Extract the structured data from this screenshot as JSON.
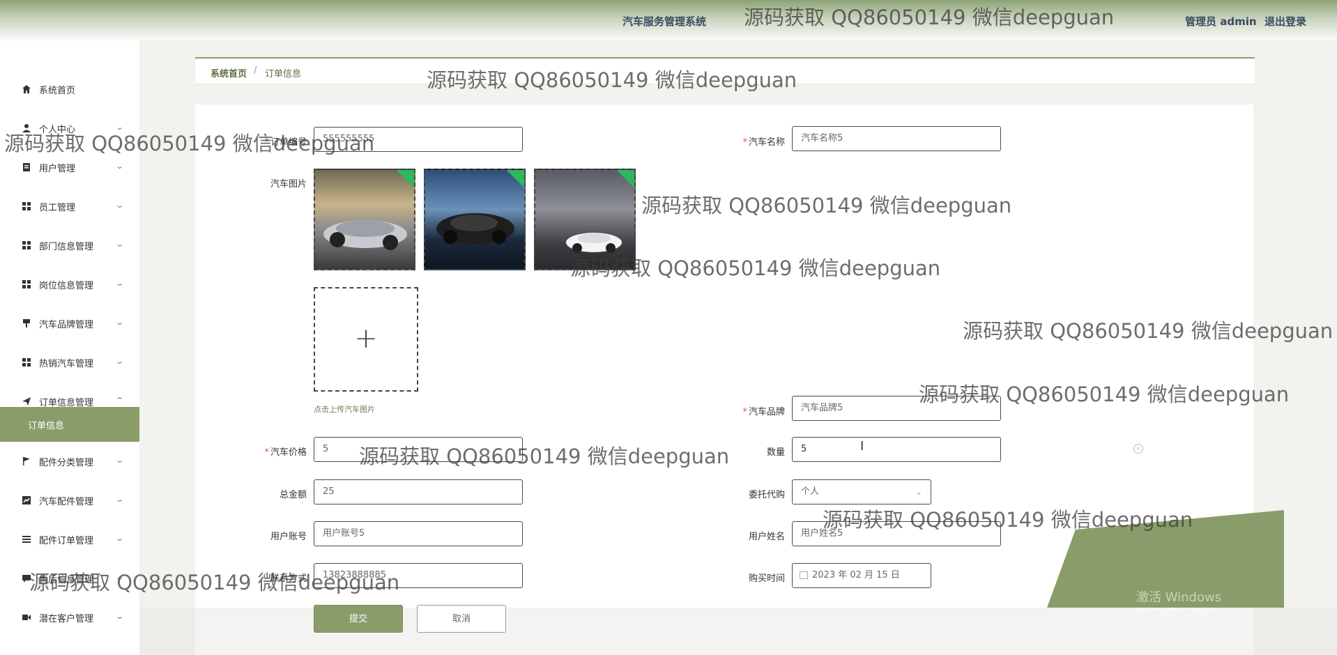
{
  "header": {
    "system_title": "汽车服务管理系统",
    "admin_label": "管理员 admin",
    "logout_label": "退出登录"
  },
  "sidebar": {
    "items": [
      {
        "label": "系统首页",
        "icon": "home-icon"
      },
      {
        "label": "个人中心",
        "icon": "user-icon"
      },
      {
        "label": "用户管理",
        "icon": "document-icon"
      },
      {
        "label": "员工管理",
        "icon": "grid-icon"
      },
      {
        "label": "部门信息管理",
        "icon": "grid-icon"
      },
      {
        "label": "岗位信息管理",
        "icon": "grid-icon"
      },
      {
        "label": "汽车品牌管理",
        "icon": "brush-icon"
      },
      {
        "label": "热销汽车管理",
        "icon": "grid-icon"
      },
      {
        "label": "订单信息管理",
        "icon": "send-icon"
      },
      {
        "label": "配件分类管理",
        "icon": "flag-icon"
      },
      {
        "label": "汽车配件管理",
        "icon": "chart-icon"
      },
      {
        "label": "配件订单管理",
        "icon": "list-icon"
      },
      {
        "label": "售后信息管理",
        "icon": "chat-icon"
      },
      {
        "label": "潜在客户管理",
        "icon": "video-icon"
      }
    ],
    "active_sub_item": "订单信息"
  },
  "breadcrumb": {
    "home": "系统首页",
    "separator": "/",
    "current": "订单信息"
  },
  "form": {
    "order_no_label": "订单编号",
    "order_no_value": "555555555",
    "car_name_label": "汽车名称",
    "car_name_value": "汽车名称5",
    "car_image_label": "汽车图片",
    "upload_hint": "点击上传汽车图片",
    "car_brand_label": "汽车品牌",
    "car_brand_value": "汽车品牌5",
    "car_price_label": "汽车价格",
    "car_price_value": "5",
    "quantity_label": "数量",
    "quantity_value": "5",
    "total_label": "总金额",
    "total_value": "25",
    "entrust_label": "委托代购",
    "entrust_value": "个人",
    "user_account_label": "用户账号",
    "user_account_value": "用户账号5",
    "user_name_label": "用户姓名",
    "user_name_value": "用户姓名5",
    "contact_label": "联系方式",
    "contact_value": "13823888885",
    "purchase_time_label": "购买时间",
    "purchase_time_value": "2023 年 02 月 15 日",
    "submit_label": "提交",
    "cancel_label": "取消"
  },
  "watermark": "源码获取 QQ86050149 微信deepguan",
  "os_notice": {
    "title": "激活 Windows",
    "subtitle": "转到\"设置\"以激活 Windows。"
  },
  "colors": {
    "accent": "#8a9c6a",
    "required": "#e05454",
    "header_text": "#3b4a63"
  }
}
